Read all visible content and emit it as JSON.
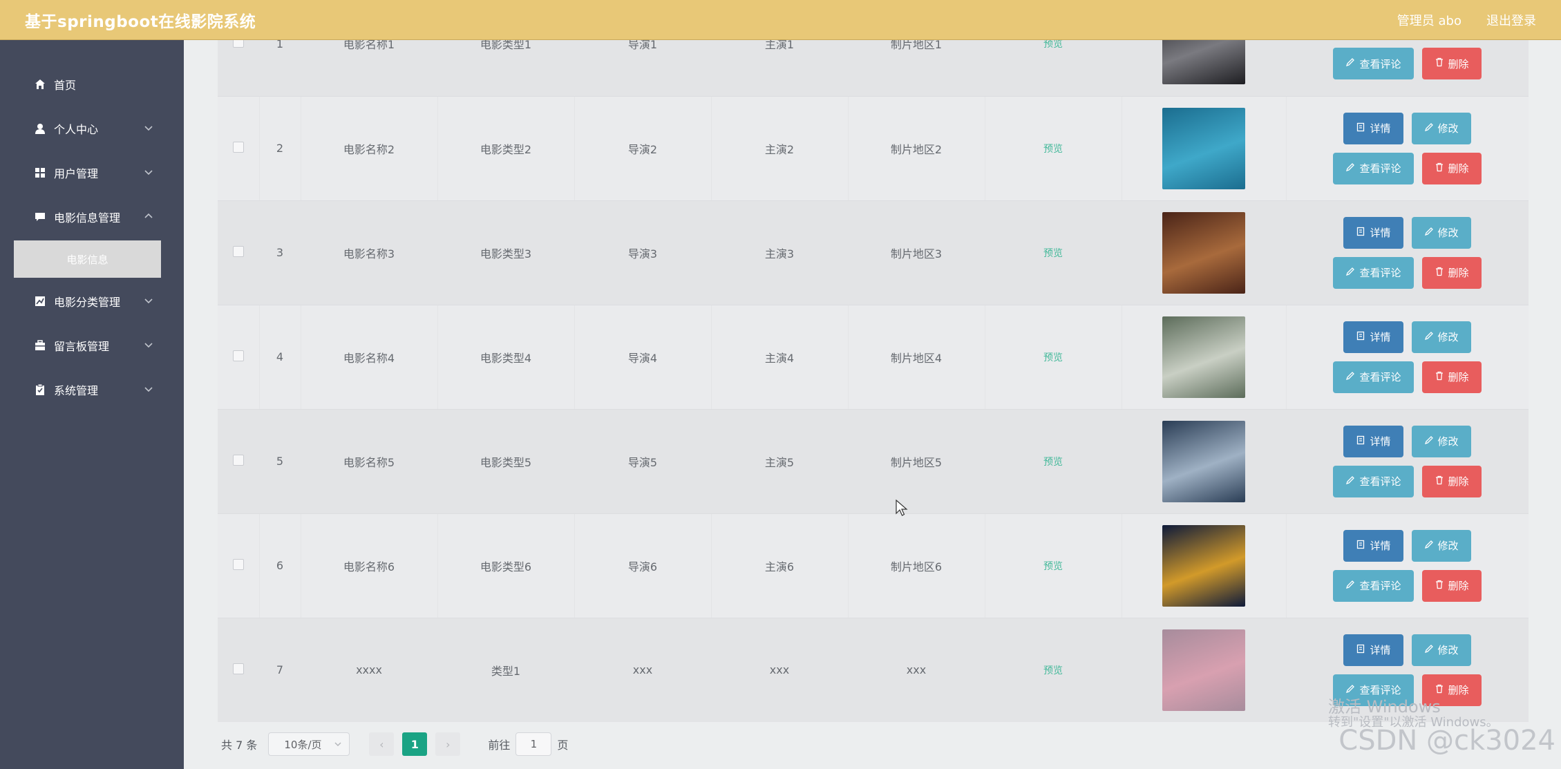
{
  "header": {
    "title": "基于springboot在线影院系统",
    "user": "管理员 abo",
    "logout": "退出登录"
  },
  "sidebar": {
    "items": [
      {
        "label": "首页",
        "icon": "home-icon",
        "has_chevron": false
      },
      {
        "label": "个人中心",
        "icon": "user-icon",
        "has_chevron": true
      },
      {
        "label": "用户管理",
        "icon": "grid-icon",
        "has_chevron": true
      },
      {
        "label": "电影信息管理",
        "icon": "comment-icon",
        "has_chevron": true
      },
      {
        "label": "电影分类管理",
        "icon": "chart-icon",
        "has_chevron": true
      },
      {
        "label": "留言板管理",
        "icon": "briefcase-icon",
        "has_chevron": true
      },
      {
        "label": "系统管理",
        "icon": "clipboard-icon",
        "has_chevron": true
      }
    ],
    "submenu_active": "电影信息"
  },
  "table": {
    "status_label": "预览",
    "buttons": {
      "detail": "详情",
      "edit": "修改",
      "comment": "查看评论",
      "delete": "删除"
    },
    "rows": [
      {
        "index": "1",
        "name": "电影名称1",
        "type": "电影类型1",
        "director": "导演1",
        "actor": "主演1",
        "region": "制片地区1",
        "poster_colors": [
          "#1e1e22",
          "#7a7a80"
        ]
      },
      {
        "index": "2",
        "name": "电影名称2",
        "type": "电影类型2",
        "director": "导演2",
        "actor": "主演2",
        "region": "制片地区2",
        "poster_colors": [
          "#1b6d8f",
          "#3fa8c9"
        ]
      },
      {
        "index": "3",
        "name": "电影名称3",
        "type": "电影类型3",
        "director": "导演3",
        "actor": "主演3",
        "region": "制片地区3",
        "poster_colors": [
          "#4a2418",
          "#a86a3c"
        ]
      },
      {
        "index": "4",
        "name": "电影名称4",
        "type": "电影类型4",
        "director": "导演4",
        "actor": "主演4",
        "region": "制片地区4",
        "poster_colors": [
          "#5c6c5a",
          "#c9cfc4"
        ]
      },
      {
        "index": "5",
        "name": "电影名称5",
        "type": "电影类型5",
        "director": "导演5",
        "actor": "主演5",
        "region": "制片地区5",
        "poster_colors": [
          "#2a3d55",
          "#9fb1c4"
        ]
      },
      {
        "index": "6",
        "name": "电影名称6",
        "type": "电影类型6",
        "director": "导演6",
        "actor": "主演6",
        "region": "制片地区6",
        "poster_colors": [
          "#0e1a3a",
          "#d29a2a"
        ]
      },
      {
        "index": "7",
        "name": "xxxx",
        "type": "类型1",
        "director": "xxx",
        "actor": "xxx",
        "region": "xxx",
        "poster_colors": [
          "#a78c9c",
          "#d8a0b0"
        ]
      }
    ]
  },
  "pagination": {
    "total": "共 7 条",
    "page_size": "10条/页",
    "prev_icon": "chevron-left-icon",
    "current": "1",
    "next_icon": "chevron-right-icon",
    "goto_prefix": "前往",
    "goto_value": "1",
    "goto_suffix": "页"
  },
  "watermark": {
    "line1": "激活 Windows",
    "line2": "转到\"设置\"以激活 Windows。",
    "credit": "CSDN @ck3024"
  },
  "colors": {
    "header_bg": "#e8c877",
    "sidebar_bg": "#444a5c",
    "status": "#44b99a",
    "primary": "#1aa384",
    "danger": "#e85d5d",
    "info": "#5aaec8",
    "detail": "#3f7fb6"
  }
}
